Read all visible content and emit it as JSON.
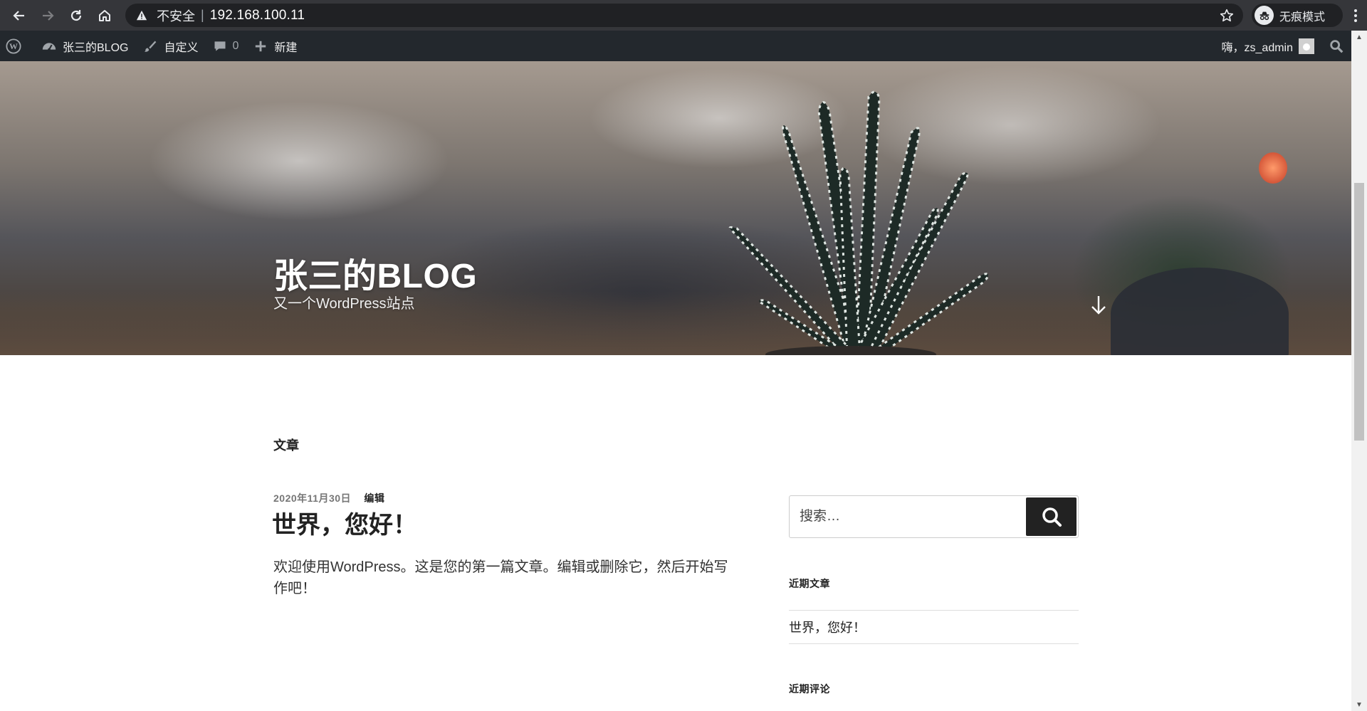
{
  "browser": {
    "insecure_label": "不安全",
    "separator": "|",
    "url": "192.168.100.11",
    "incognito_label": "无痕模式"
  },
  "admin_bar": {
    "site_name": "张三的BLOG",
    "customize": "自定义",
    "comments_count": "0",
    "new": "新建",
    "greeting": "嗨，zs_admin"
  },
  "hero": {
    "site_title": "张三的BLOG",
    "site_description": "又一个WordPress站点"
  },
  "content": {
    "page_heading": "文章",
    "post": {
      "date": "2020年11月30日",
      "edit": "编辑",
      "title": "世界，您好！",
      "excerpt": "欢迎使用WordPress。这是您的第一篇文章。编辑或删除它，然后开始写作吧！"
    }
  },
  "sidebar": {
    "search_placeholder": "搜索…",
    "recent_posts_title": "近期文章",
    "recent_posts": [
      "世界，您好！"
    ],
    "recent_comments_title": "近期评论"
  },
  "colors": {
    "browser_bar": "#35363a",
    "omnibox": "#202124",
    "admin_bar": "#23282d",
    "text_dark": "#222222",
    "meta_gray": "#767676"
  }
}
